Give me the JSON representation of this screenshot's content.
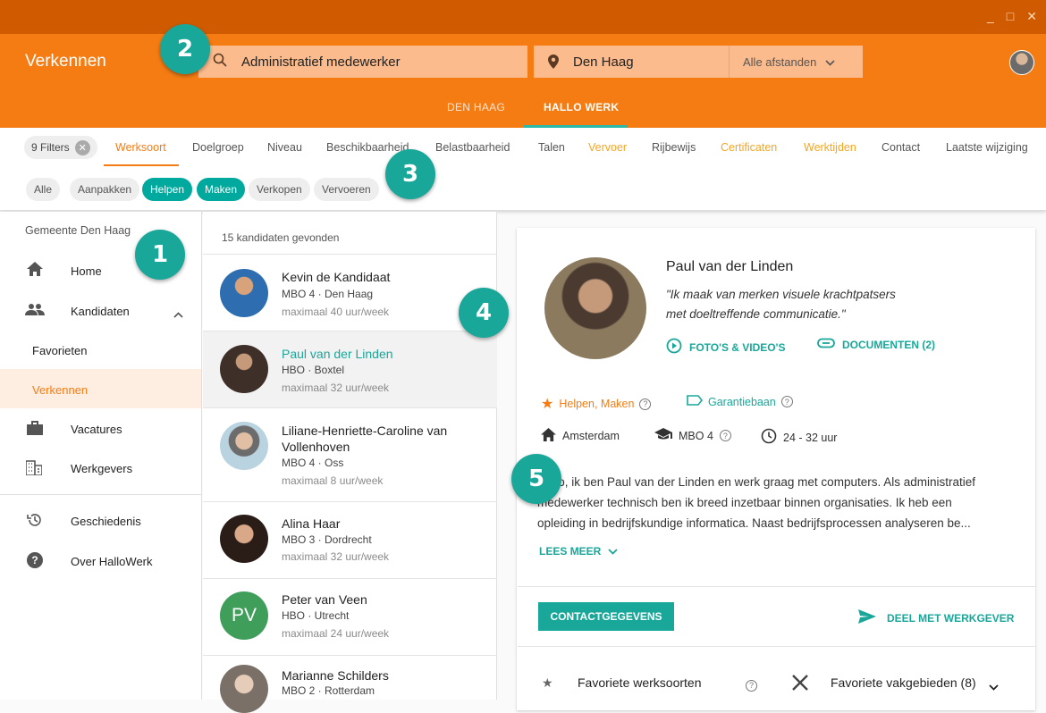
{
  "window_controls": {
    "minimize": "_",
    "maximize": "□",
    "close": "✕"
  },
  "header": {
    "title": "Verkennen",
    "search_value": "Administratief medewerker",
    "location_value": "Den Haag",
    "distance_value": "Alle afstanden",
    "tabs": [
      "DEN HAAG",
      "HALLO WERK"
    ],
    "accent": "#f57c13"
  },
  "filters": {
    "count_label": "9 Filters",
    "tabs": [
      "Werksoort",
      "Doelgroep",
      "Niveau",
      "Beschikbaarheid",
      "Belastbaarheid",
      "Talen",
      "Vervoer",
      "Rijbewijs",
      "Certificaten",
      "Werktijden",
      "Contact",
      "Laatste wijziging"
    ],
    "chips": [
      "Alle",
      "Aanpakken",
      "Helpen",
      "Maken",
      "Verkopen",
      "Vervoeren"
    ]
  },
  "sidebar": {
    "heading": "Gemeente Den Haag",
    "items": [
      "Home",
      "Kandidaten",
      "Favorieten",
      "Verkennen",
      "Vacatures",
      "Werkgevers",
      "Geschiedenis",
      "Over HalloWerk"
    ]
  },
  "list": {
    "count_text": "15 kandidaten gevonden",
    "candidates": [
      {
        "name": "Kevin de Kandidaat",
        "sub": "MBO 4 · Den Haag",
        "hours": "maximaal 40 uur/week"
      },
      {
        "name": "Paul van der Linden",
        "sub": "HBO · Boxtel",
        "hours": "maximaal 32 uur/week"
      },
      {
        "name": "Liliane-Henriette-Caroline van",
        "name2": "Vollenhoven",
        "sub": "MBO 4 · Oss",
        "hours": "maximaal 8 uur/week"
      },
      {
        "name": "Alina Haar",
        "sub": "MBO 3 · Dordrecht",
        "hours": "maximaal 32 uur/week"
      },
      {
        "name": "Peter van Veen",
        "initials": "PV",
        "sub": "HBO · Utrecht",
        "hours": "maximaal 24 uur/week"
      },
      {
        "name": "Marianne Schilders",
        "sub": "MBO 2 · Rotterdam"
      }
    ]
  },
  "detail": {
    "name": "Paul van der Linden",
    "quote1": "\"Ik maak van merken visuele krachtpatsers",
    "quote2": "met doeltreffende communicatie.\"",
    "photos_link": "FOTO'S & VIDEO'S",
    "docs_link": "DOCUMENTEN (2)",
    "tag1": "Helpen, Maken",
    "tag2": "Garantiebaan",
    "city": "Amsterdam",
    "level": "MBO 4",
    "hours": "24 - 32 uur",
    "bio1": "Hallo, ik ben Paul van der Linden en werk graag met computers. Als administratief",
    "bio2": "medewerker technisch ben ik breed inzetbaar binnen organisaties. Ik heb een",
    "bio3": "opleiding in bedrijfskundige informatica. Naast bedrijfsprocessen analyseren be...",
    "read_more": "LEES MEER",
    "contact_button": "CONTACTGEGEVENS",
    "share_button": "DEEL MET WERKGEVER",
    "fav1": "Favoriete werksoorten",
    "fav2": "Favoriete vakgebieden (8)"
  },
  "badges": [
    "1",
    "2",
    "3",
    "4",
    "5"
  ]
}
